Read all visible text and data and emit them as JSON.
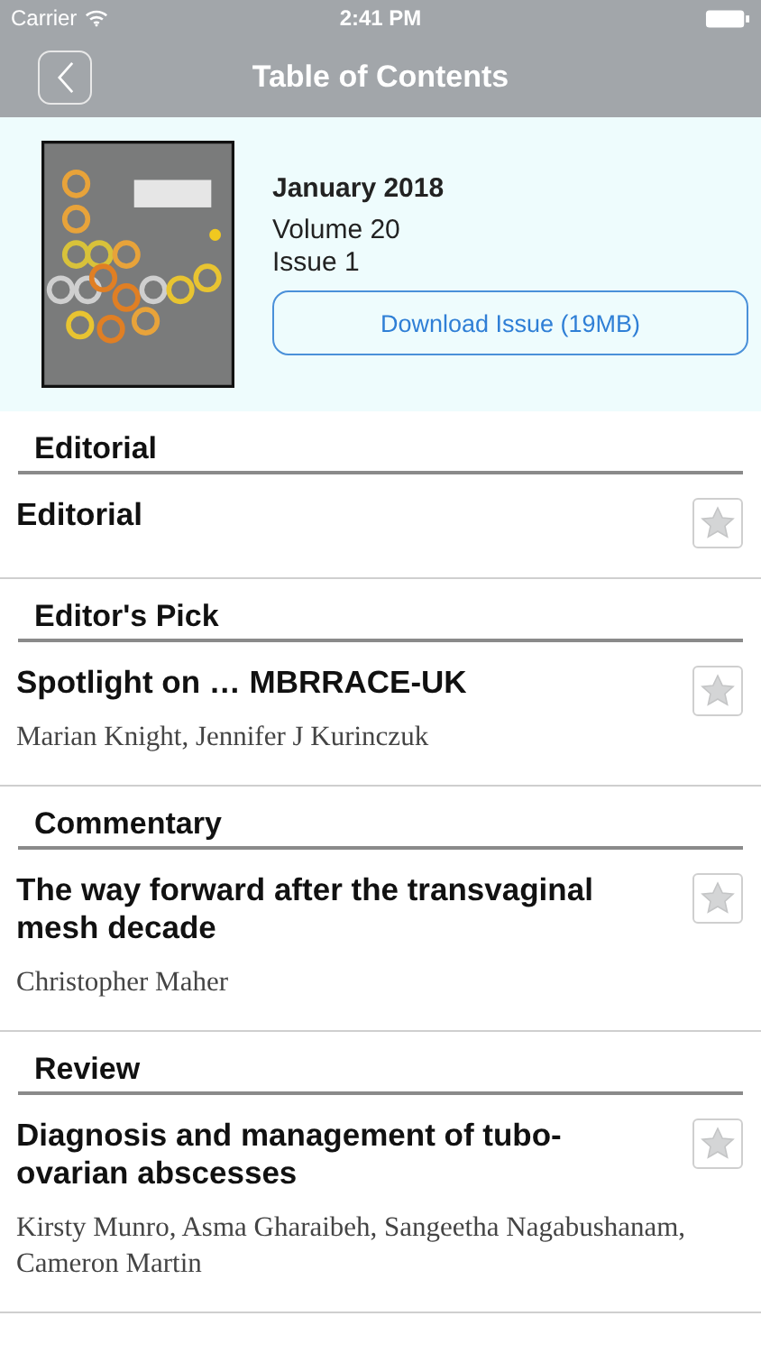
{
  "status_bar": {
    "carrier": "Carrier",
    "time": "2:41 PM"
  },
  "nav": {
    "title": "Table of Contents"
  },
  "issue": {
    "date": "January 2018",
    "volume": "Volume 20",
    "number": "Issue 1",
    "download_button": "Download Issue (19MB)"
  },
  "sections": [
    {
      "heading": "Editorial",
      "articles": [
        {
          "title": "Editorial",
          "starred": false
        }
      ]
    },
    {
      "heading": "Editor's Pick",
      "articles": [
        {
          "title": "Spotlight on … MBRRACE-UK",
          "authors": "Marian Knight, Jennifer J Kurinczuk",
          "starred": false
        }
      ]
    },
    {
      "heading": "Commentary",
      "articles": [
        {
          "title": "The way forward after the transvaginal mesh decade",
          "authors": "Christopher Maher",
          "starred": false
        }
      ]
    },
    {
      "heading": "Review",
      "articles": [
        {
          "title": "Diagnosis and management of tubo-ovarian abscesses",
          "authors": "Kirsty Munro, Asma Gharaibeh, Sangeetha Nagabushanam, Cameron Martin",
          "starred": false
        }
      ]
    }
  ]
}
